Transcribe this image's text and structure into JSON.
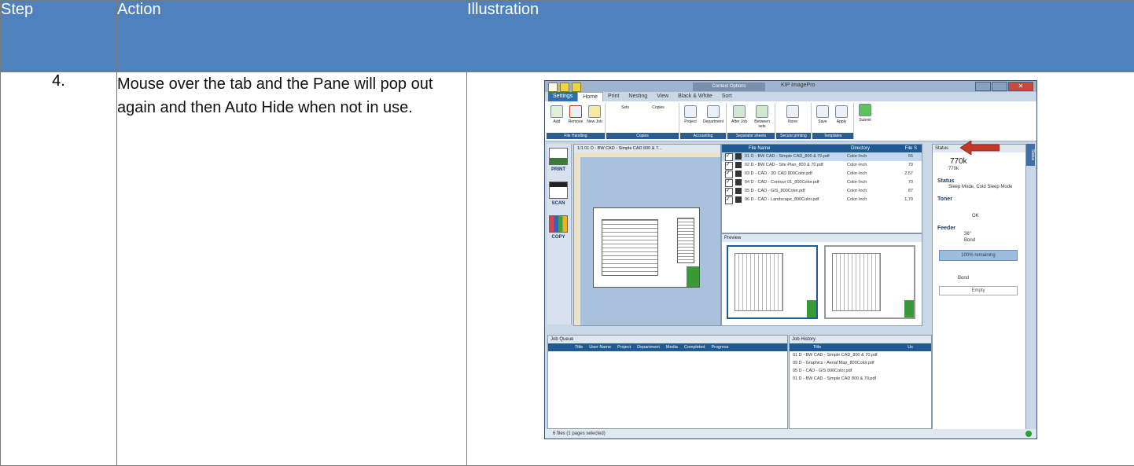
{
  "headers": {
    "step": "Step",
    "action": "Action",
    "illustration": "Illustration"
  },
  "row": {
    "step": "4.",
    "action": "Mouse over the tab and the Pane will pop out again and then Auto Hide when not in use."
  },
  "app": {
    "ctx_tab": "Context Options",
    "app_name": "KIP ImagePro",
    "tabs": [
      "Settings",
      "Home",
      "Print",
      "Nesting",
      "View",
      "Black & White",
      "Sort"
    ],
    "ribbon_buttons": [
      "Add",
      "Remove",
      "New Job",
      "Sets",
      "Copies",
      "Project",
      "Department",
      "After Job",
      "Between sets",
      "None",
      "Save",
      "Apply",
      "Submit"
    ],
    "ribbon_groups": [
      "File Handling",
      "Copies",
      "Accounting",
      "Separator sheets",
      "Secure printing",
      "Templates"
    ],
    "sidebar": [
      "PRINT",
      "SCAN",
      "COPY"
    ],
    "viewer_title": "1/1  01 D - BW CAD - Simple CAD 800 & 7...",
    "file_columns": {
      "name": "File Name",
      "directory": "Directory",
      "size": "File S"
    },
    "files": [
      {
        "name": "01 D - BW CAD - Simple CAD_800 & 70.pdf",
        "dir": "Color-Inch",
        "size": "55"
      },
      {
        "name": "02 D - BW CAD - Site Plan_800 & 70.pdf",
        "dir": "Color-Inch",
        "size": "79"
      },
      {
        "name": "03 D - CAD - 3D CAD 800Color.pdf",
        "dir": "Color-Inch",
        "size": "2,57"
      },
      {
        "name": "04 D - CAD - Contour 01_800Color.pdf",
        "dir": "Color-Inch",
        "size": "70"
      },
      {
        "name": "05 D - CAD - GIS_800Color.pdf",
        "dir": "Color-Inch",
        "size": "87"
      },
      {
        "name": "06 D - CAD - Landscape_800Color.pdf",
        "dir": "Color-Inch",
        "size": "1,70"
      }
    ],
    "preview_title": "Preview",
    "status_title": "Status",
    "status_tab": "Status",
    "counter": "770k",
    "counter_sub": "770k",
    "status_label": "Status",
    "status_value": "Sleep Mode, Cold Sleep Mode",
    "toner_label": "Toner",
    "toner_value": "OK",
    "feeder_label": "Feeder",
    "feeder_size": "36\"",
    "feeder_media": "Bond",
    "remaining": "100% remaining",
    "feeder2_media": "Bond",
    "feeder2_state": "Empty",
    "queue_title": "Job Queue",
    "queue_columns": [
      "Title",
      "User Name",
      "Project",
      "Department",
      "Media",
      "Completed",
      "Progress"
    ],
    "history_title": "Job History",
    "history_columns": [
      "Title",
      "Us"
    ],
    "history_rows": [
      "01 D - BW CAD - Simple CAD_800 & 70.pdf",
      "09 D - Graphics - Aerial Map_800Color.pdf",
      "05 D - CAD - GIS 800Color.pdf",
      "01 D - BW CAD - Simple CAD 800 & 70.pdf"
    ],
    "statusbar": "6 files   (1 pages selected)"
  },
  "colors": {
    "header": "#4f81bd",
    "arrow": "#c0392b"
  }
}
